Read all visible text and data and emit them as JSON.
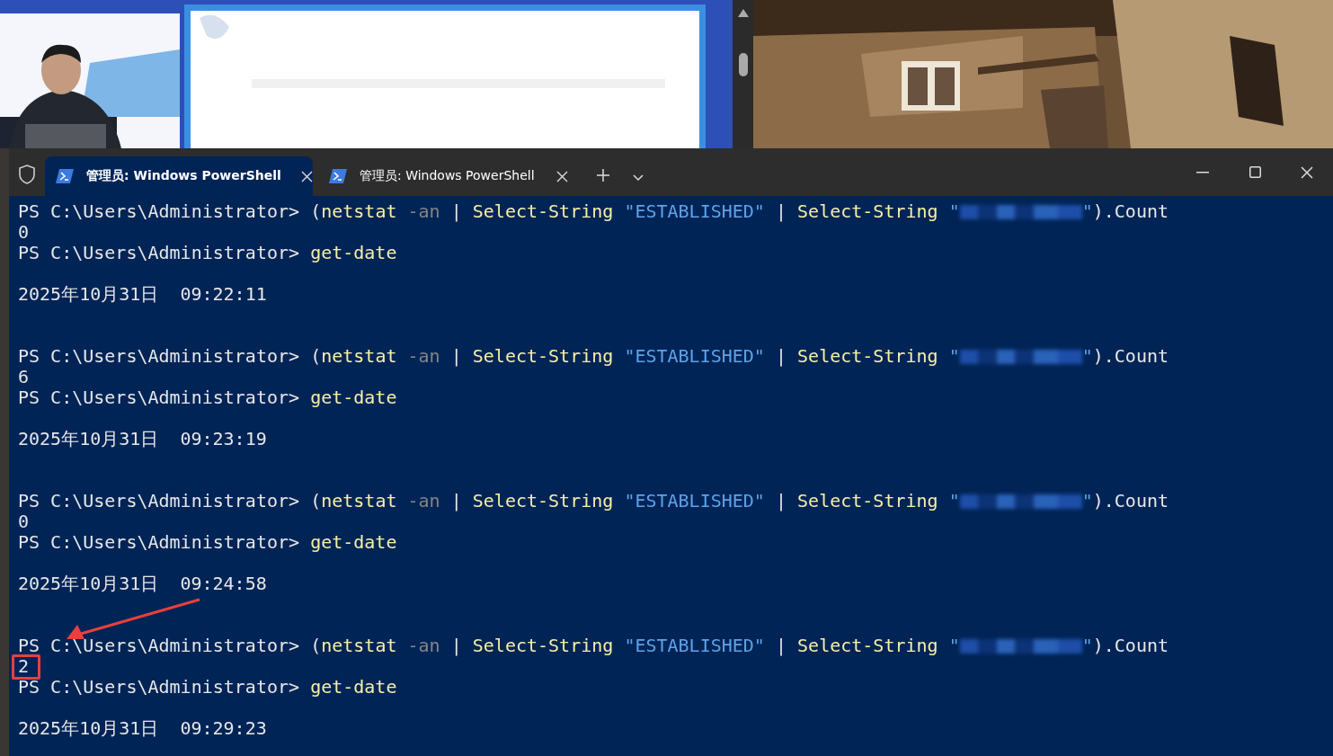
{
  "window": {
    "tabs": [
      {
        "label": "管理员: Windows PowerShell",
        "selected": true
      },
      {
        "label": "管理员: Windows PowerShell",
        "selected": false
      }
    ]
  },
  "terminal": {
    "blocks": [
      {
        "prompt": "PS C:\\Users\\Administrator>",
        "command": [
          {
            "kind": "plain",
            "text": "("
          },
          {
            "kind": "command",
            "text": "netstat",
            "attached": true
          },
          {
            "kind": "parameter",
            "text": "-an"
          },
          {
            "kind": "plain",
            "text": "|"
          },
          {
            "kind": "command",
            "text": "Select-String"
          },
          {
            "kind": "string",
            "text": "\"ESTABLISHED\""
          },
          {
            "kind": "plain",
            "text": "|"
          },
          {
            "kind": "command",
            "text": "Select-String"
          },
          {
            "kind": "string",
            "text": "\""
          },
          {
            "kind": "redacted"
          },
          {
            "kind": "string",
            "text": "\"",
            "attached": true
          },
          {
            "kind": "plain",
            "text": ").Count",
            "attached": true
          }
        ],
        "result": "0",
        "highlighted": false,
        "prompt2": "PS C:\\Users\\Administrator>",
        "command2": [
          {
            "kind": "command",
            "text": "get-date"
          }
        ],
        "date": "2025年10月31日  09:22:11"
      },
      {
        "prompt": "PS C:\\Users\\Administrator>",
        "command": [
          {
            "kind": "plain",
            "text": "("
          },
          {
            "kind": "command",
            "text": "netstat",
            "attached": true
          },
          {
            "kind": "parameter",
            "text": "-an"
          },
          {
            "kind": "plain",
            "text": "|"
          },
          {
            "kind": "command",
            "text": "Select-String"
          },
          {
            "kind": "string",
            "text": "\"ESTABLISHED\""
          },
          {
            "kind": "plain",
            "text": "|"
          },
          {
            "kind": "command",
            "text": "Select-String"
          },
          {
            "kind": "string",
            "text": "\""
          },
          {
            "kind": "redacted"
          },
          {
            "kind": "string",
            "text": "\"",
            "attached": true
          },
          {
            "kind": "plain",
            "text": ").Count",
            "attached": true
          }
        ],
        "result": "6",
        "highlighted": false,
        "prompt2": "PS C:\\Users\\Administrator>",
        "command2": [
          {
            "kind": "command",
            "text": "get-date"
          }
        ],
        "date": "2025年10月31日  09:23:19"
      },
      {
        "prompt": "PS C:\\Users\\Administrator>",
        "command": [
          {
            "kind": "plain",
            "text": "("
          },
          {
            "kind": "command",
            "text": "netstat",
            "attached": true
          },
          {
            "kind": "parameter",
            "text": "-an"
          },
          {
            "kind": "plain",
            "text": "|"
          },
          {
            "kind": "command",
            "text": "Select-String"
          },
          {
            "kind": "string",
            "text": "\"ESTABLISHED\""
          },
          {
            "kind": "plain",
            "text": "|"
          },
          {
            "kind": "command",
            "text": "Select-String"
          },
          {
            "kind": "string",
            "text": "\""
          },
          {
            "kind": "redacted"
          },
          {
            "kind": "string",
            "text": "\"",
            "attached": true
          },
          {
            "kind": "plain",
            "text": ").Count",
            "attached": true
          }
        ],
        "result": "0",
        "highlighted": false,
        "prompt2": "PS C:\\Users\\Administrator>",
        "command2": [
          {
            "kind": "command",
            "text": "get-date"
          }
        ],
        "date": "2025年10月31日  09:24:58"
      },
      {
        "prompt": "PS C:\\Users\\Administrator>",
        "command": [
          {
            "kind": "plain",
            "text": "("
          },
          {
            "kind": "command",
            "text": "netstat",
            "attached": true
          },
          {
            "kind": "parameter",
            "text": "-an"
          },
          {
            "kind": "plain",
            "text": "|"
          },
          {
            "kind": "command",
            "text": "Select-String"
          },
          {
            "kind": "string",
            "text": "\"ESTABLISHED\""
          },
          {
            "kind": "plain",
            "text": "|"
          },
          {
            "kind": "command",
            "text": "Select-String"
          },
          {
            "kind": "string",
            "text": "\""
          },
          {
            "kind": "redacted"
          },
          {
            "kind": "string",
            "text": "\"",
            "attached": true
          },
          {
            "kind": "plain",
            "text": ").Count",
            "attached": true
          }
        ],
        "result": "2",
        "highlighted": true,
        "prompt2": "PS C:\\Users\\Administrator>",
        "command2": [
          {
            "kind": "command",
            "text": "get-date"
          }
        ],
        "date": "2025年10月31日  09:29:23"
      }
    ]
  }
}
